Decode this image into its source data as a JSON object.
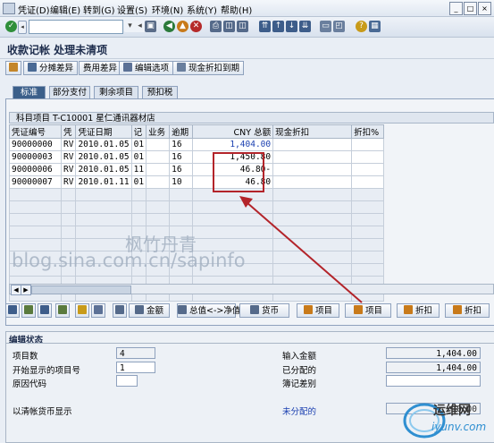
{
  "menu": {
    "items": [
      "凭证(D)",
      "编辑(E)",
      "转到(G)",
      "设置(S)",
      "环境(N)",
      "系统(Y)",
      "帮助(H)"
    ]
  },
  "window_controls": [
    "_",
    "□",
    "×"
  ],
  "page_title": "收款记帐 处理未清项",
  "actions": {
    "distribute_diff": "分摊差异",
    "charge_diff": "费用差异",
    "edit_options": "编辑选项",
    "cash_discount_due": "现金折扣到期"
  },
  "tabs": [
    "标准",
    "部分支付",
    "剩余项目",
    "预扣税"
  ],
  "table": {
    "title": "科目项目 T-C10001 星仁通讯器材店",
    "columns": [
      "凭证编号",
      "凭",
      "凭证日期",
      "记",
      "业务",
      "逾期",
      "CNY 总额",
      "现金折扣",
      "折扣%"
    ],
    "rows": [
      {
        "doc": "90000000",
        "type": "RV",
        "date": "2010.01.05",
        "pk": "01",
        "bus": "",
        "days": "16",
        "amount": "1,404.00",
        "disc": "",
        "pct": ""
      },
      {
        "doc": "90000003",
        "type": "RV",
        "date": "2010.01.05",
        "pk": "01",
        "bus": "",
        "days": "16",
        "amount": "1,450.80",
        "disc": "",
        "pct": ""
      },
      {
        "doc": "90000006",
        "type": "RV",
        "date": "2010.01.05",
        "pk": "11",
        "bus": "",
        "days": "16",
        "amount": "46.80-",
        "disc": "",
        "pct": ""
      },
      {
        "doc": "90000007",
        "type": "RV",
        "date": "2010.01.11",
        "pk": "01",
        "bus": "",
        "days": "10",
        "amount": "46.80",
        "disc": "",
        "pct": ""
      }
    ]
  },
  "watermark": {
    "line1": "枫竹丹青",
    "line2": "blog.sina.com.cn/sapinfo"
  },
  "lower_buttons": {
    "amount": "金额",
    "gross_net": "总值<->净值",
    "currency": "货币",
    "item1": "项目",
    "item2": "项目",
    "discount1": "折扣",
    "discount2": "折扣"
  },
  "status": {
    "title": "编辑状态",
    "item_count_label": "项目数",
    "item_count": "4",
    "first_item_label": "开始显示的项目号",
    "first_item": "1",
    "reason_label": "原因代码",
    "reason": "",
    "clearing_label": "以清帐货币显示",
    "entered_label": "输入金额",
    "entered": "1,404.00",
    "assigned_label": "已分配的",
    "assigned": "1,404.00",
    "diff_label": "簿记差别",
    "diff": "",
    "unassigned_label": "未分配的",
    "unassigned": "0.00"
  },
  "logo": {
    "brand": "运维网",
    "domain": "iyunv.com"
  },
  "colors": {
    "accent": "#3b5f8a",
    "annotation_red": "#b3242a",
    "amount_blue": "#1a3fb0"
  }
}
